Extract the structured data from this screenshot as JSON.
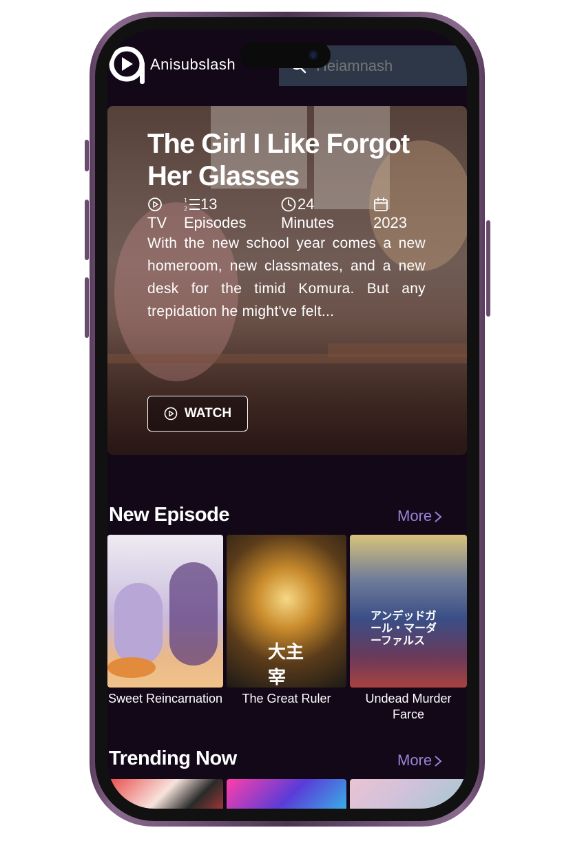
{
  "app": {
    "name": "Anisubslash",
    "search_placeholder": "Heiamnash"
  },
  "hero": {
    "title": "The Girl I Like Forgot Her Glasses",
    "type": "TV",
    "episodes_num": "13",
    "episodes_label": "Episodes",
    "duration_num": "24",
    "duration_label": "Minutes",
    "year": "2023",
    "description": "With the new school year comes a new homeroom, new classmates, and a new desk for the timid Komura. But any trepidation he might've felt...",
    "watch_label": "WATCH"
  },
  "new_episode": {
    "title": "New Episode",
    "more_label": "More",
    "items": [
      {
        "title": "Sweet Reincarnation"
      },
      {
        "title": "The Great Ruler"
      },
      {
        "title": "Undead Murder Farce"
      }
    ]
  },
  "trending": {
    "title": "Trending Now",
    "more_label": "More"
  },
  "colors": {
    "background": "#120818",
    "accent": "#9b82d8",
    "search_bg": "#2e3748"
  }
}
